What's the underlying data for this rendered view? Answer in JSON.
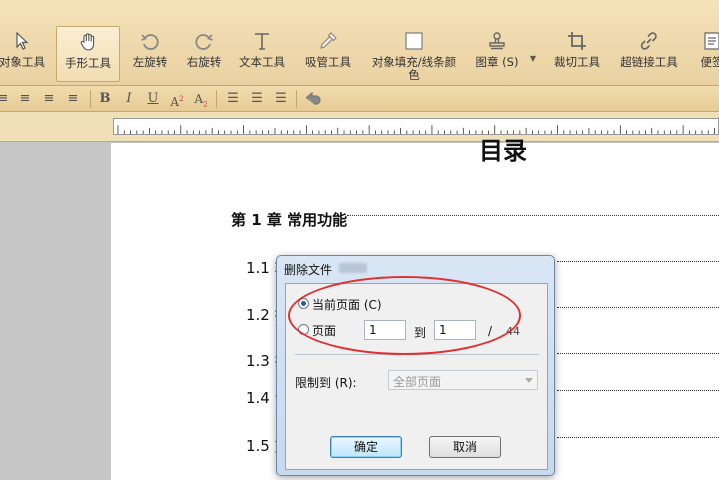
{
  "toolbar": {
    "tools": [
      {
        "label": "对象工具",
        "icon": "cursor-arrow-icon"
      },
      {
        "label": "手形工具",
        "icon": "hand-icon"
      },
      {
        "label": "左旋转",
        "icon": "rotate-left-icon"
      },
      {
        "label": "右旋转",
        "icon": "rotate-right-icon"
      },
      {
        "label": "文本工具",
        "icon": "text-tool-icon"
      },
      {
        "label": "吸管工具",
        "icon": "eyedropper-icon"
      },
      {
        "label": "对象填充/线条颜",
        "label2": "色",
        "icon": "fill-color-icon"
      },
      {
        "label": "图章 (S)",
        "icon": "stamp-icon"
      },
      {
        "label": "裁切工具",
        "icon": "crop-icon"
      },
      {
        "label": "超链接工具",
        "icon": "hyperlink-icon"
      },
      {
        "label": "便签",
        "icon": "sticky-note-icon"
      }
    ]
  },
  "formatbar": {
    "bold": "B",
    "italic": "I",
    "underline": "U"
  },
  "document": {
    "heading": "目录",
    "chapter": "第 1 章  常用功能",
    "sections": [
      "1.1 ",
      "1.2 ",
      "1.3 ",
      "1.4 ",
      "1.5 "
    ],
    "section_suffix": [
      "软",
      "打",
      "打",
      "合",
      "文"
    ]
  },
  "dialog": {
    "title": "删除文件",
    "current_page_label": "当前页面 (C)",
    "pages_label": "页面",
    "from_value": "1",
    "to_label": "到",
    "to_value": "1",
    "separator": "/",
    "total_pages": "44",
    "limit_label": "限制到 (R):",
    "limit_value": "全部页面",
    "ok_label": "确定",
    "cancel_label": "取消"
  },
  "colors": {
    "highlight_ellipse": "#e03030"
  }
}
